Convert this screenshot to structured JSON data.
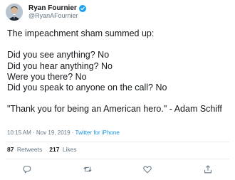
{
  "user": {
    "display_name": "Ryan Fournier",
    "handle": "@RyanAFournier",
    "verified": true,
    "accent_color": "#1da1f2"
  },
  "tweet": {
    "lines": [
      "The impeachment sham summed up:",
      "",
      "Did you see anything? No",
      "Did you hear anything? No",
      "Were you there? No",
      "Did you speak to anyone on the call? No",
      "",
      "\"Thank you for being an American hero.\" - Adam Schiff"
    ]
  },
  "meta": {
    "time": "10:15 AM",
    "separator": "·",
    "date": "Nov 19, 2019",
    "source": "Twitter for iPhone"
  },
  "stats": {
    "retweets_count": "87",
    "retweets_label": "Retweets",
    "likes_count": "217",
    "likes_label": "Likes"
  },
  "actions": {
    "icons": [
      "reply-icon",
      "retweet-icon",
      "like-icon",
      "share-icon"
    ],
    "icon_color": "#657786"
  }
}
